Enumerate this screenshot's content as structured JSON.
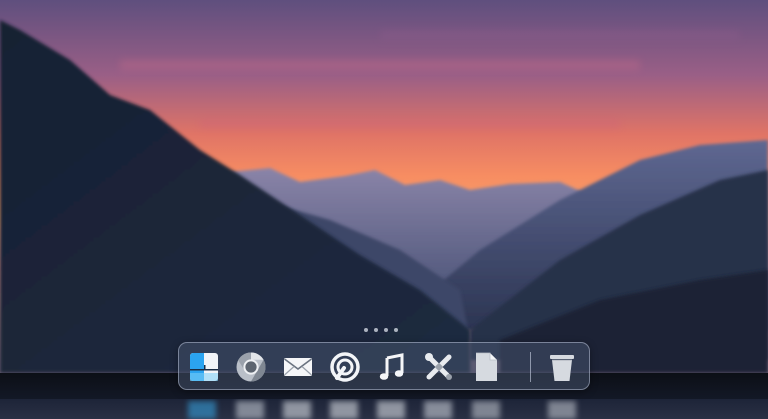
{
  "desktop": {
    "wallpaper": "mountain-sunset",
    "colors": {
      "sky_top": "#6b5a86",
      "sky_mid": "#e77662",
      "sky_glow": "#f59f62",
      "mountain_near": "#1a2538",
      "mountain_far": "#6a6f9a",
      "shelf": "#0f131d"
    }
  },
  "dock": {
    "page_indicator_count": 4,
    "items": [
      {
        "id": "files",
        "icon": "file-manager-icon"
      },
      {
        "id": "browser",
        "icon": "chrome-icon"
      },
      {
        "id": "mail",
        "icon": "mail-icon"
      },
      {
        "id": "torrent",
        "icon": "transmission-icon"
      },
      {
        "id": "music",
        "icon": "music-note-icon"
      },
      {
        "id": "tools",
        "icon": "tools-icon"
      },
      {
        "id": "documents",
        "icon": "document-icon"
      },
      {
        "id": "trash",
        "icon": "trash-icon"
      }
    ]
  }
}
